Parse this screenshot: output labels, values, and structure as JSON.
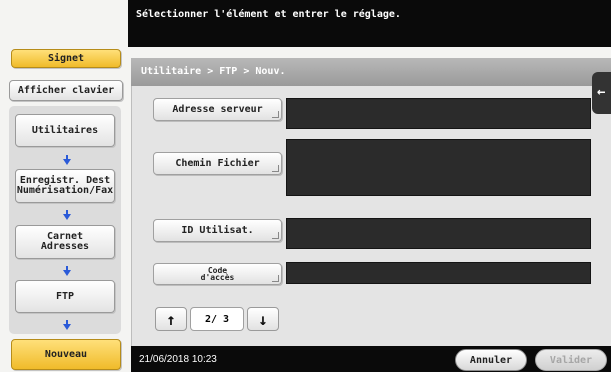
{
  "instruction": "Sélectionner l'élément et entrer le réglage.",
  "left_panel": {
    "bookmark_label": "Signet",
    "keyboard_label": "Afficher clavier",
    "trail": [
      {
        "label_line1": "Utilitaires",
        "label_line2": ""
      },
      {
        "label_line1": "Enregistr. Dest",
        "label_line2": "Numérisation/Fax"
      },
      {
        "label_line1": "Carnet",
        "label_line2": "Adresses"
      },
      {
        "label_line1": "FTP",
        "label_line2": ""
      }
    ],
    "current_label": "Nouveau"
  },
  "breadcrumb": "Utilitaire > FTP > Nouv.",
  "fields": {
    "server_address": {
      "label": "Adresse serveur",
      "value": ""
    },
    "file_path": {
      "label": "Chemin Fichier",
      "value": ""
    },
    "user_id": {
      "label": "ID Utilisat.",
      "value": ""
    },
    "password": {
      "label_line1": "Code",
      "label_line2": "d'accès",
      "value": ""
    }
  },
  "pager": {
    "current": 2,
    "total": 3,
    "display": "2/ 3",
    "up_icon": "arrow-up-icon",
    "down_icon": "arrow-down-icon"
  },
  "status": {
    "datetime": "21/06/2018   10:23"
  },
  "actions": {
    "cancel": "Annuler",
    "validate": "Valider"
  },
  "colors": {
    "accent_yellow": "#f0bb2a",
    "arrow_blue": "#2a5ad8",
    "field_dark": "#2b2b2b",
    "bar_black": "#0a0a0a"
  }
}
